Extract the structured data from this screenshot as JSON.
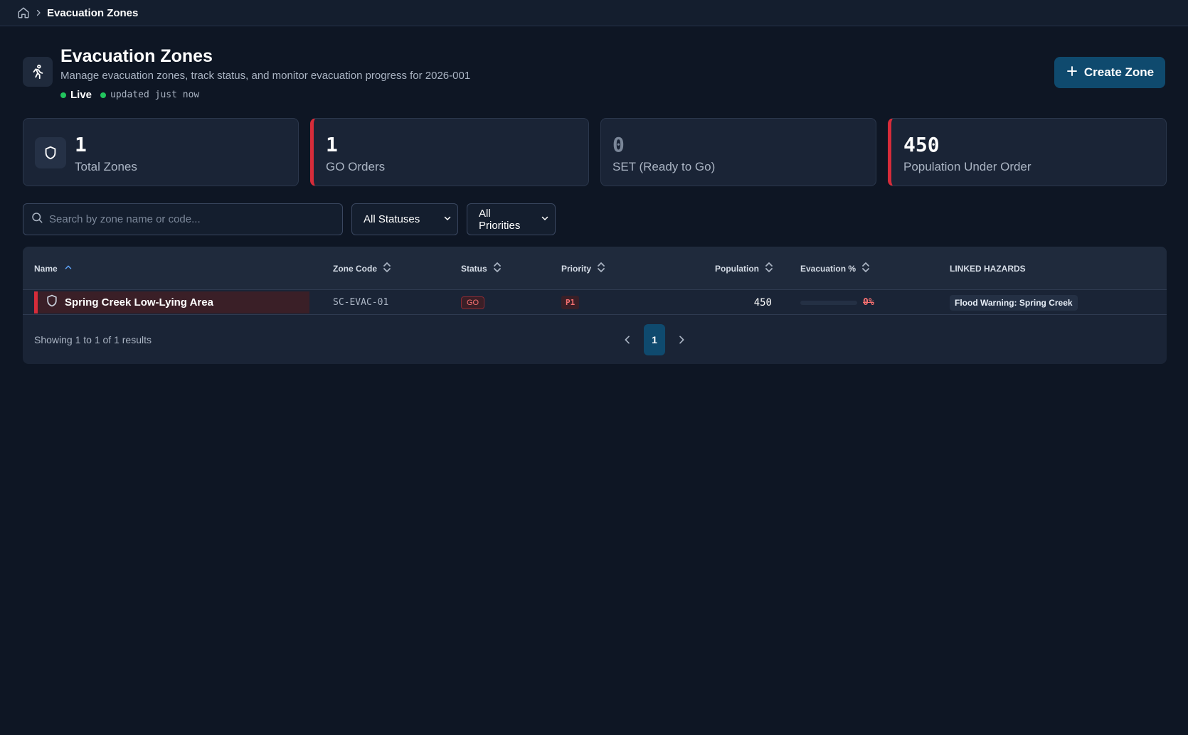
{
  "breadcrumb": {
    "home_icon": "home-icon",
    "separator_icon": "chevron-right-icon",
    "current": "Evacuation Zones"
  },
  "header": {
    "icon": "running-person-icon",
    "title": "Evacuation Zones",
    "subtitle": "Manage evacuation zones, track status, and monitor evacuation progress for 2026-001",
    "live_label": "Live",
    "updated_label": "updated just now",
    "live_color": "#22c55e"
  },
  "actions": {
    "create_label": "Create Zone",
    "create_icon": "plus-icon"
  },
  "stats": [
    {
      "value": "1",
      "label": "Total Zones",
      "icon": "shield-icon"
    },
    {
      "value": "1",
      "label": "GO Orders",
      "accent": "#d62c3a"
    },
    {
      "value": "0",
      "label": "SET (Ready to Go)"
    },
    {
      "value": "450",
      "label": "Population Under Order",
      "accent": "#d62c3a"
    }
  ],
  "filters": {
    "search_placeholder": "Search by zone name or code...",
    "status_selected": "All Statuses",
    "priority_selected": "All Priorities"
  },
  "table": {
    "columns": {
      "name": "Name",
      "zone_code": "Zone Code",
      "status": "Status",
      "priority": "Priority",
      "population": "Population",
      "evacuation": "Evacuation %",
      "hazards": "LINKED HAZARDS"
    },
    "rows": [
      {
        "name": "Spring Creek Low-Lying Area",
        "zone_code": "SC-EVAC-01",
        "status": "GO",
        "priority": "P1",
        "population": "450",
        "evacuation_pct_label": "0%",
        "evacuation_fraction": 0,
        "hazard": "Flood Warning: Spring Creek"
      }
    ],
    "footer_text": "Showing 1 to 1 of 1 results",
    "current_page": "1"
  },
  "colors": {
    "background": "#0e1624",
    "card": "#1a2436",
    "accent_red": "#d62c3a",
    "primary_button": "#0f4a6e"
  }
}
